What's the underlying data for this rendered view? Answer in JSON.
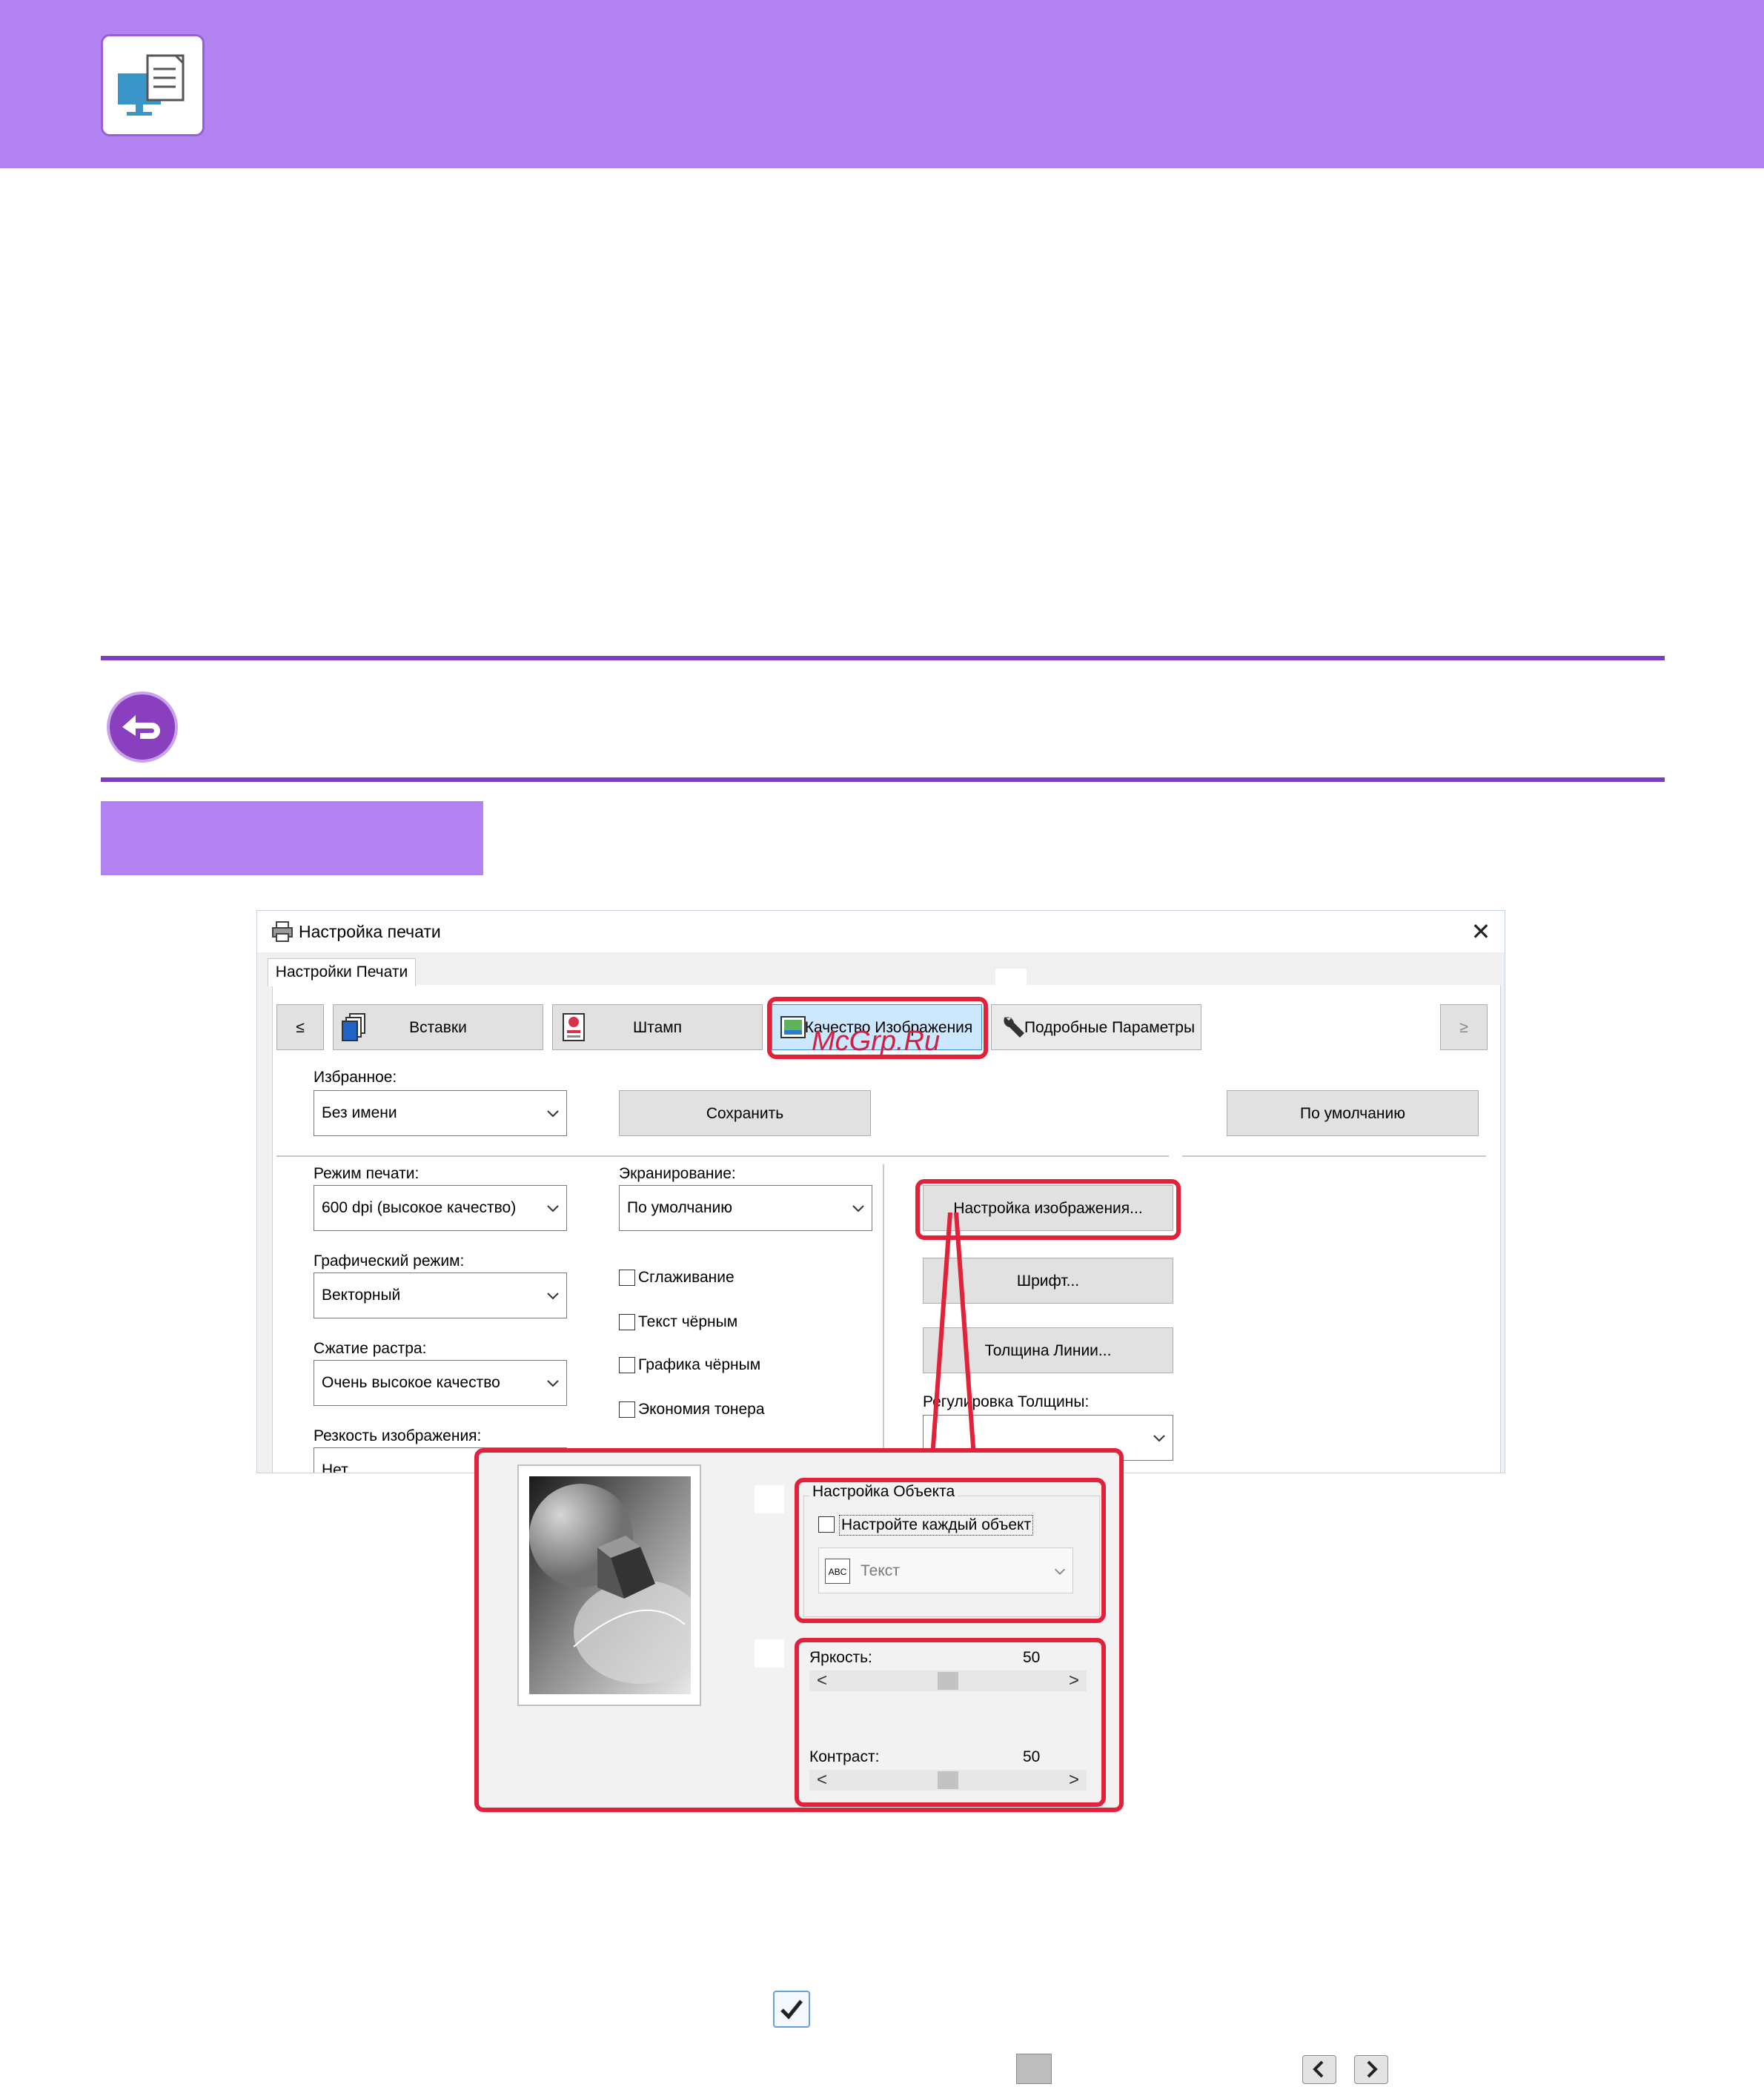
{
  "dialog": {
    "title": "Настройка печати",
    "close_glyph": "✕",
    "main_tab": "Настройки Печати",
    "nav_prev": "≤",
    "nav_next": "≥",
    "tabs": [
      {
        "label": "Вставки",
        "icon": "copies-icon"
      },
      {
        "label": "Штамп",
        "icon": "stamp-icon"
      },
      {
        "label": "Качество Изображения",
        "icon": "image-quality-icon",
        "selected": true
      },
      {
        "label": "Подробные Параметры",
        "icon": "wrench-icon"
      }
    ],
    "watermark": "McGrp.Ru",
    "favorites": {
      "label": "Избранное:",
      "value": "Без имени"
    },
    "save_button": "Сохранить",
    "default_button": "По умолчанию",
    "print_mode": {
      "label": "Режим печати:",
      "value": "600 dpi (высокое качество)"
    },
    "screening": {
      "label": "Экранирование:",
      "value": "По умолчанию"
    },
    "graphics_mode": {
      "label": "Графический режим:",
      "value": "Векторный"
    },
    "raster_compression": {
      "label": "Сжатие растра:",
      "value": "Очень высокое качество"
    },
    "sharpness": {
      "label": "Резкость изображения:",
      "value": "Нет"
    },
    "checkboxes": [
      {
        "label": "Сглаживание",
        "checked": false
      },
      {
        "label": "Текст чёрным",
        "checked": false
      },
      {
        "label": "Графика чёрным",
        "checked": false
      },
      {
        "label": "Экономия тонера",
        "checked": false
      }
    ],
    "image_settings_button": "Настройка изображения...",
    "font_button": "Шрифт...",
    "line_width_button": "Толщина Линии...",
    "thickness_label": "Регулировка Толщины:",
    "thickness_value": ""
  },
  "popup": {
    "object_group_title": "Настройка Объекта",
    "each_object_checkbox": "Настройте каждый объект",
    "each_object_checked": false,
    "object_combo_icon_text": "ABC",
    "object_combo_value": "Текст",
    "brightness": {
      "label": "Яркость:",
      "value": "50",
      "level": 50
    },
    "contrast": {
      "label": "Контраст:",
      "value": "50",
      "level": 50
    },
    "arrow_left": "<",
    "arrow_right": ">"
  },
  "colors": {
    "header": "#b383f2",
    "rule": "#7b3dc0",
    "highlight": "#e2223b",
    "selected_tab": "#cce8ff"
  },
  "icons": {
    "header": "printer-monitor-icon",
    "back": "back-arrow-icon",
    "bottom": [
      "checkmark-icon",
      "slider-thumb-icon",
      "arrow-left-icon",
      "arrow-right-icon"
    ]
  }
}
